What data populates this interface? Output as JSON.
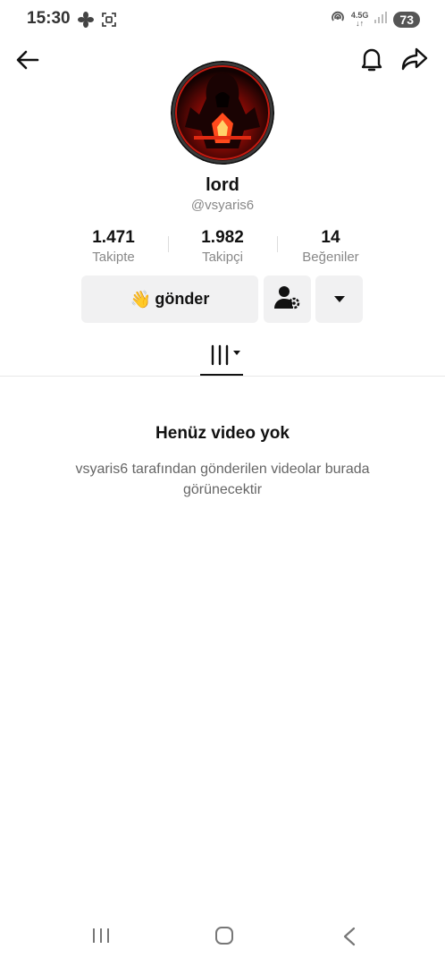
{
  "status_bar": {
    "time": "15:30",
    "network": "4.5G",
    "battery": "73",
    "icons": [
      "fan-icon",
      "screenshot-icon",
      "hotspot-icon",
      "signal-icon"
    ]
  },
  "header": {
    "icons": [
      "back-arrow-icon",
      "bell-icon",
      "share-icon"
    ]
  },
  "profile": {
    "name": "lord",
    "handle": "@vsyaris6"
  },
  "stats": [
    {
      "value": "1.471",
      "label": "Takipte"
    },
    {
      "value": "1.982",
      "label": "Takipçi"
    },
    {
      "value": "14",
      "label": "Beğeniler"
    }
  ],
  "actions": {
    "send_label": "gönder",
    "send_emoji": "👋"
  },
  "empty": {
    "title": "Henüz video yok",
    "description": "vsyaris6 tarafından gönderilen videolar burada görünecektir"
  },
  "colors": {
    "button_bg": "#f1f1f2",
    "text_primary": "#111111",
    "text_secondary": "#888888"
  }
}
